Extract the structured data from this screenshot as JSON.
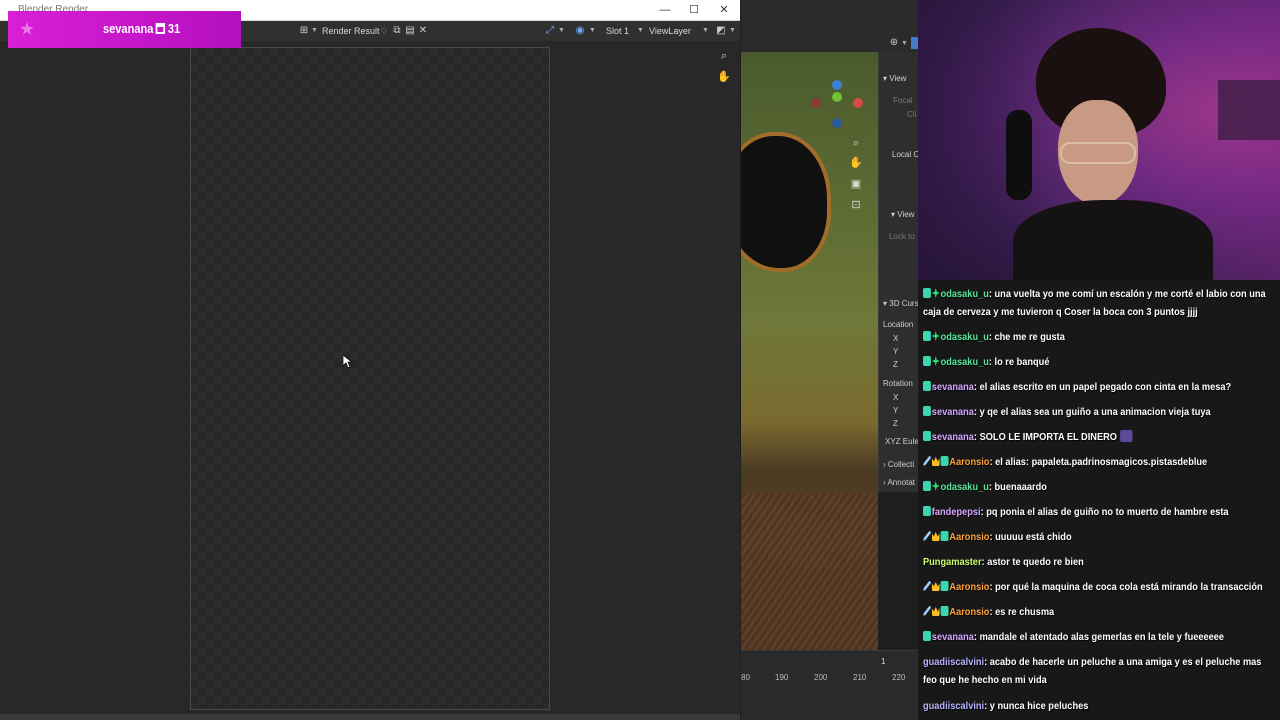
{
  "render_window": {
    "title": "Blender Render",
    "controls": {
      "minimize": "—",
      "maximize": "☐",
      "close": "✕"
    },
    "header": {
      "image_name": "Render Result",
      "slot": "Slot 1",
      "view_layer": "ViewLayer"
    }
  },
  "viewport": {
    "npanel": {
      "view_tab": "View",
      "focal": "Focal",
      "clip": "Cli",
      "local_camera": "Local C",
      "view_lock": "View",
      "lock_to": "Lock to",
      "cursor_3d": "3D Curs",
      "location": "Location",
      "axis_x": "X",
      "axis_y": "Y",
      "axis_z": "Z",
      "rotation": "Rotation",
      "rot_x": "X",
      "rot_y": "Y",
      "rot_z": "Z",
      "rot_mode": "XYZ Eule",
      "collections": "Collecti",
      "annotations": "Annotat"
    },
    "timeline": {
      "current_frame": "1",
      "ticks": [
        "80",
        "190",
        "200",
        "210",
        "220"
      ]
    }
  },
  "goal": {
    "user": "sevanana",
    "count": "31"
  },
  "chat": {
    "messages": [
      {
        "user": "odasaku_u",
        "text": "una vuelta yo me comí un escalón y me corté el labio con una caja de cerveza y me tuvieron q Coser la boca con 3 puntos jjjj"
      },
      {
        "user": "odasaku_u",
        "text": "che me re gusta"
      },
      {
        "user": "odasaku_u",
        "text": "lo re banqué"
      },
      {
        "user": "sevanana",
        "text": "el alias escrito en un papel pegado con cinta en la mesa?"
      },
      {
        "user": "sevanana",
        "text": "y qe el alias sea un guiño a una animacion vieja tuya"
      },
      {
        "user": "sevanana",
        "text": "SOLO LE IMPORTA EL DINERO"
      },
      {
        "user": "Aaronsio",
        "text": "el alias: papaleta.padrinosmagicos.pistasdeblue"
      },
      {
        "user": "odasaku_u",
        "text": "buenaaardo"
      },
      {
        "user": "fandepepsi",
        "text": "pq ponia el alias de guiño no to muerto de hambre esta"
      },
      {
        "user": "Aaronsio",
        "text": "uuuuu está chido"
      },
      {
        "user": "Pungamaster",
        "text": "astor te quedo re bien"
      },
      {
        "user": "Aaronsio",
        "text": "por qué la maquina de coca cola está mirando la transacción"
      },
      {
        "user": "Aaronsio",
        "text": "es re chusma"
      },
      {
        "user": "sevanana",
        "text": "mandale el atentado alas gemerlas en la tele y fueeeeee"
      },
      {
        "user": "guadiiscalvini",
        "text": "acabo de hacerle un peluche a una amiga y es el peluche mas feo que he hecho en mi vida"
      },
      {
        "user": "guadiiscalvini",
        "text": "y nunca hice peluches"
      }
    ]
  },
  "colors": {
    "goal_bg": "#c414c8",
    "blender_bg": "#282828",
    "chat_green": "#57e89a",
    "chat_pink": "#d8a5ff",
    "chat_orange": "#ffa23a"
  }
}
